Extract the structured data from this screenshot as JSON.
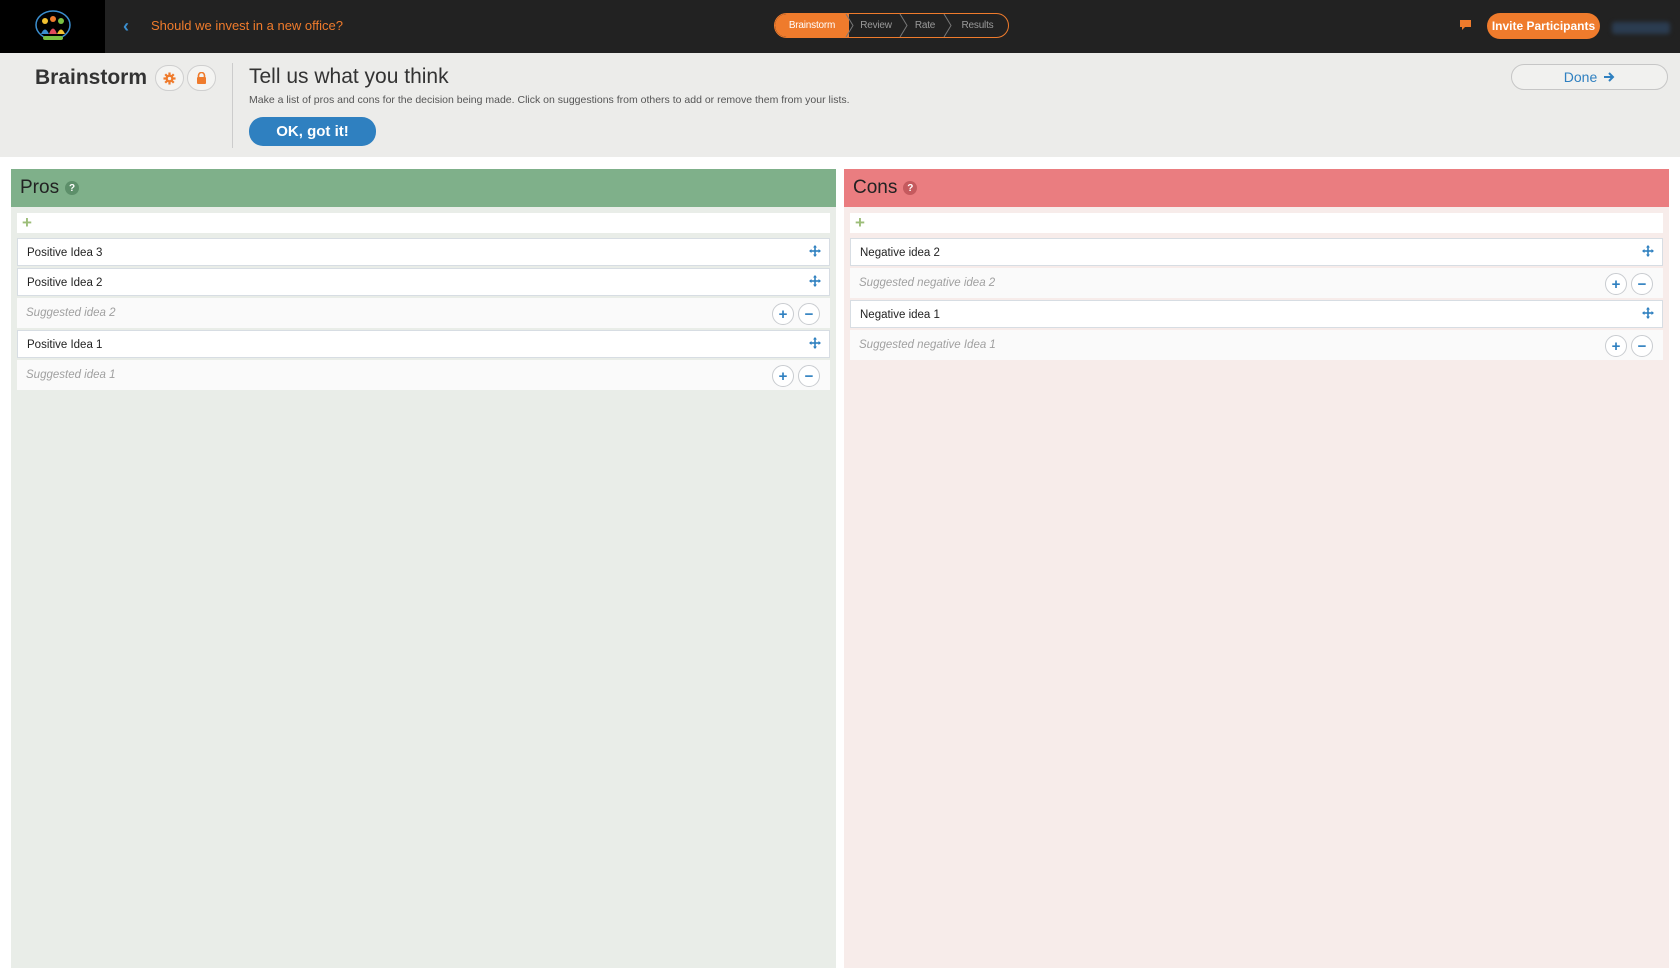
{
  "topbar": {
    "question": "Should we invest in a new office?",
    "steps": [
      "Brainstorm",
      "Review",
      "Rate",
      "Results"
    ],
    "active_step": 0,
    "invite_label": "Invite Participants"
  },
  "header": {
    "title": "Brainstorm",
    "tell_title": "Tell us what you think",
    "tell_desc": "Make a list of pros and cons for the decision being made. Click on suggestions from others to add or remove them from your lists.",
    "ok_label": "OK, got it!",
    "done_label": "Done"
  },
  "pros": {
    "title": "Pros",
    "items": [
      {
        "kind": "idea",
        "label": "Positive Idea 3"
      },
      {
        "kind": "idea",
        "label": "Positive Idea 2"
      },
      {
        "kind": "suggestion",
        "label": "Suggested idea 2"
      },
      {
        "kind": "idea",
        "label": "Positive Idea 1"
      },
      {
        "kind": "suggestion",
        "label": "Suggested idea 1"
      }
    ]
  },
  "cons": {
    "title": "Cons",
    "items": [
      {
        "kind": "idea",
        "label": "Negative idea 2"
      },
      {
        "kind": "suggestion",
        "label": "Suggested negative idea 2"
      },
      {
        "kind": "idea",
        "label": "Negative idea 1"
      },
      {
        "kind": "suggestion",
        "label": "Suggested negative Idea 1"
      }
    ]
  },
  "colors": {
    "accent": "#ef7b2c",
    "primary": "#2f80c0",
    "pros_header": "#7fb08a",
    "cons_header": "#ea7d80"
  },
  "icons": {
    "back": "chevron-left-icon",
    "settings": "gear-icon",
    "lock": "lock-icon",
    "help": "question-icon",
    "add": "plus-icon",
    "move": "move-icon",
    "accept": "plus-circle-icon",
    "reject": "minus-circle-icon",
    "chat": "chat-icon",
    "done_arrow": "arrow-right-icon"
  }
}
